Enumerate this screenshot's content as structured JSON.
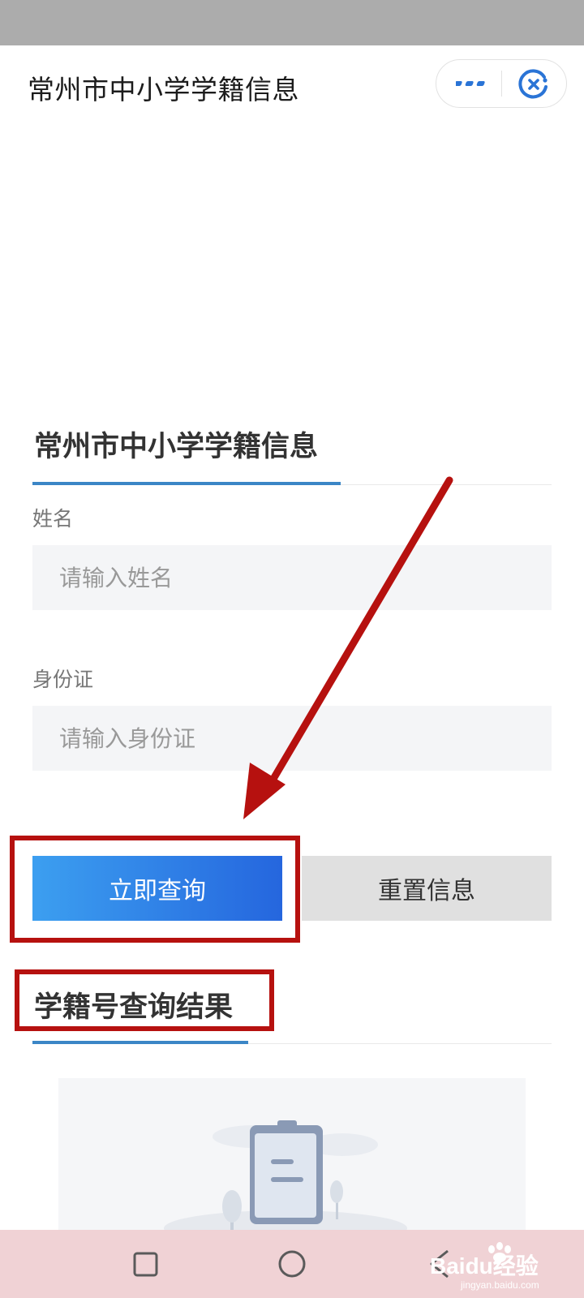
{
  "header": {
    "title": "常州市中小学学籍信息",
    "more_icon": "more-dots-icon",
    "close_icon": "close-target-icon"
  },
  "form": {
    "title": "常州市中小学学籍信息",
    "name_label": "姓名",
    "name_placeholder": "请输入姓名",
    "id_label": "身份证",
    "id_placeholder": "请输入身份证",
    "query_button": "立即查询",
    "reset_button": "重置信息"
  },
  "result": {
    "title": "学籍号查询结果",
    "empty_icon": "clipboard-icon"
  },
  "nav": {
    "recent_icon": "square-icon",
    "home_icon": "circle-icon",
    "back_icon": "triangle-back-icon"
  },
  "watermark": {
    "text": "Baidu经验",
    "url_text": "jingyan.baidu.com"
  },
  "colors": {
    "accent": "#3b86c6",
    "button_gradient_start": "#3c9ff0",
    "button_gradient_end": "#2566de",
    "annotation": "#b6110f"
  }
}
